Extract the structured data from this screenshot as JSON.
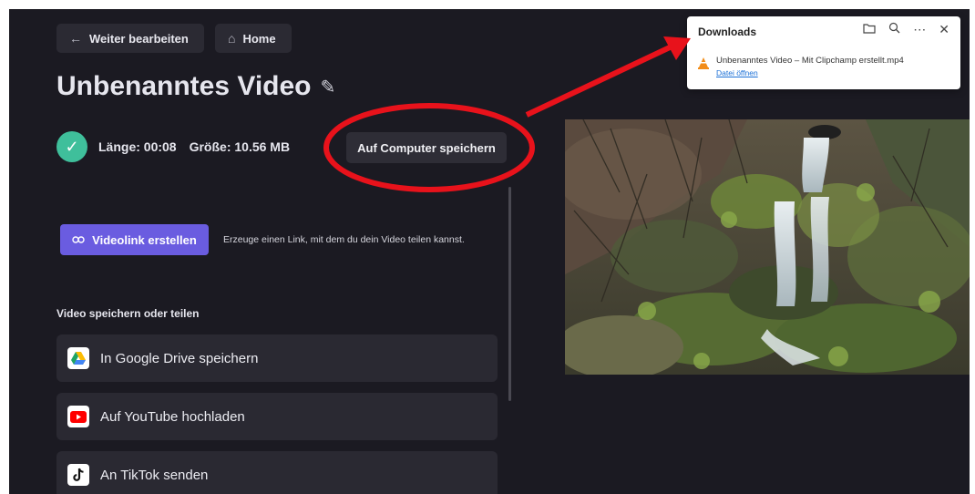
{
  "header": {
    "back_label": "Weiter bearbeiten",
    "home_label": "Home"
  },
  "video": {
    "title": "Unbenanntes Video",
    "length": "Länge: 00:08",
    "size": "Größe: 10.56 MB",
    "status": "complete"
  },
  "actions": {
    "save_label": "Auf Computer speichern",
    "link_label": "Videolink erstellen",
    "link_hint": "Erzeuge einen Link, mit dem du dein Video teilen kannst."
  },
  "share": {
    "section_title": "Video speichern oder teilen",
    "items": [
      {
        "label": "In Google Drive speichern",
        "icon": "google-drive-icon"
      },
      {
        "label": "Auf YouTube hochladen",
        "icon": "youtube-icon"
      },
      {
        "label": "An TikTok senden",
        "icon": "tiktok-icon"
      }
    ]
  },
  "downloads": {
    "title": "Downloads",
    "file_name": "Unbenanntes Video – Mit Clipchamp erstellt.mp4",
    "open_label": "Datei öffnen",
    "icons": [
      "folder-icon",
      "search-icon",
      "more-icon",
      "close-icon"
    ]
  },
  "colors": {
    "app_bg": "#1b1a22",
    "accent": "#6a5ce0",
    "success": "#3fbf9b",
    "annotation": "#e8121b"
  }
}
